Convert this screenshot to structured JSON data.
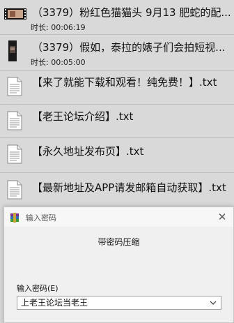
{
  "files": [
    {
      "name": "（3379）粉红色猫猫头 9月13 肥蛇的配...",
      "duration_label": "时长:",
      "duration": "00:06:19",
      "thumb_icon": "video-thumbnail-icon"
    },
    {
      "name": "（3379）假如，泰拉的婊子们会拍短视...",
      "duration_label": "时长:",
      "duration": "00:05:00",
      "thumb_icon": "video-thumbnail-icon"
    },
    {
      "name": "【来了就能下载和观看！纯免费！】.txt",
      "thumb_icon": "text-file-icon"
    },
    {
      "name": "【老王论坛介绍】.txt",
      "thumb_icon": "text-file-icon"
    },
    {
      "name": "【永久地址发布页】.txt",
      "thumb_icon": "text-file-icon"
    },
    {
      "name": "【最新地址及APP请发邮箱自动获取】.txt",
      "thumb_icon": "text-file-icon"
    }
  ],
  "dialog": {
    "title": "输入密码",
    "heading": "带密码压缩",
    "field_label": "输入密码(E)",
    "field_value": "上老王论坛当老王",
    "close_symbol": "✕",
    "app_icon": "winrar-icon"
  },
  "colors": {
    "list_background": "#d9d9d9",
    "dialog_background": "#f0f0f0"
  }
}
